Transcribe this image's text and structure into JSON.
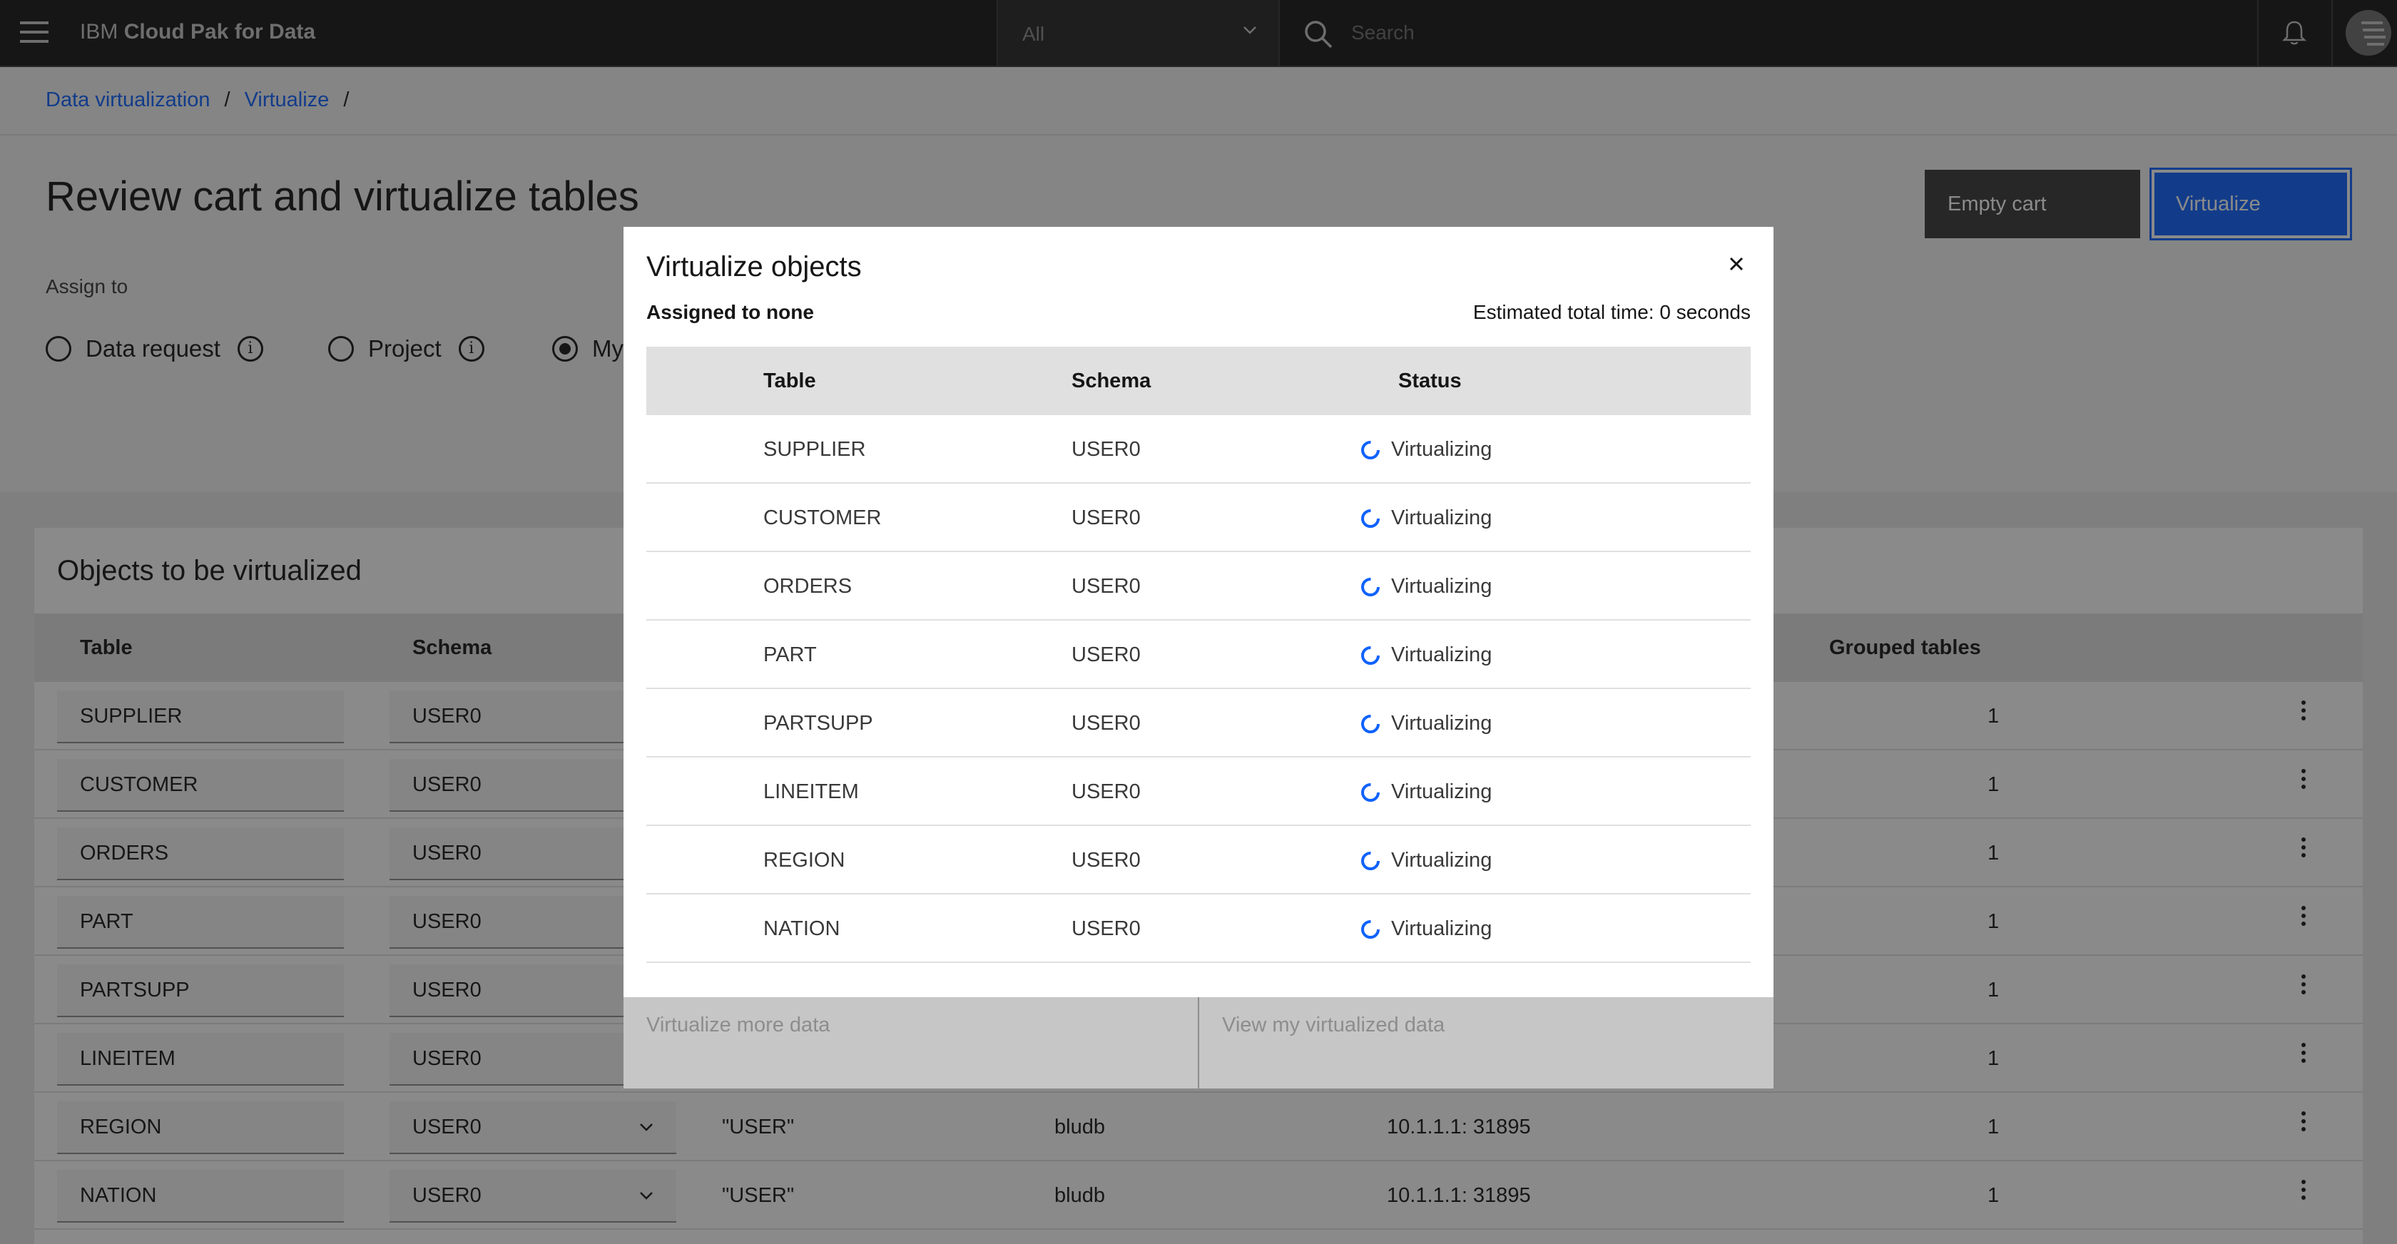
{
  "header": {
    "brand_prefix": "IBM",
    "brand_name": "Cloud Pak for Data",
    "scope_value": "All",
    "search_placeholder": "Search"
  },
  "breadcrumb": [
    "Data virtualization",
    "Virtualize"
  ],
  "page": {
    "title": "Review cart and virtualize tables",
    "empty_cart_label": "Empty cart",
    "virtualize_label": "Virtualize",
    "assign_label": "Assign to",
    "radio_options": [
      "Data request",
      "Project",
      "My"
    ],
    "selected_radio": "My"
  },
  "objects_panel": {
    "title": "Objects to be virtualized",
    "columns": [
      "Table",
      "Schema",
      "Grouped tables"
    ],
    "rows": [
      {
        "table": "SUPPLIER",
        "schema": "USER0",
        "grouped": "1"
      },
      {
        "table": "CUSTOMER",
        "schema": "USER0",
        "grouped": "1"
      },
      {
        "table": "ORDERS",
        "schema": "USER0",
        "grouped": "1"
      },
      {
        "table": "PART",
        "schema": "USER0",
        "grouped": "1"
      },
      {
        "table": "PARTSUPP",
        "schema": "USER0",
        "grouped": "1"
      },
      {
        "table": "LINEITEM",
        "schema": "USER0",
        "grouped": "1"
      },
      {
        "table": "REGION",
        "schema": "USER0",
        "owner": "\"USER\"",
        "database": "bludb",
        "host": "10.1.1.1: 31895",
        "grouped": "1"
      },
      {
        "table": "NATION",
        "schema": "USER0",
        "owner": "\"USER\"",
        "database": "bludb",
        "host": "10.1.1.1: 31895",
        "grouped": "1"
      }
    ]
  },
  "modal": {
    "title": "Virtualize objects",
    "assigned": "Assigned to none",
    "estimated": "Estimated total time: 0 seconds",
    "columns": [
      "Table",
      "Schema",
      "Status"
    ],
    "rows": [
      {
        "table": "SUPPLIER",
        "schema": "USER0",
        "status": "Virtualizing"
      },
      {
        "table": "CUSTOMER",
        "schema": "USER0",
        "status": "Virtualizing"
      },
      {
        "table": "ORDERS",
        "schema": "USER0",
        "status": "Virtualizing"
      },
      {
        "table": "PART",
        "schema": "USER0",
        "status": "Virtualizing"
      },
      {
        "table": "PARTSUPP",
        "schema": "USER0",
        "status": "Virtualizing"
      },
      {
        "table": "LINEITEM",
        "schema": "USER0",
        "status": "Virtualizing"
      },
      {
        "table": "REGION",
        "schema": "USER0",
        "status": "Virtualizing"
      },
      {
        "table": "NATION",
        "schema": "USER0",
        "status": "Virtualizing"
      }
    ],
    "footer_secondary": "Virtualize more data",
    "footer_primary": "View my virtualized data"
  },
  "icons": {
    "menu": "hamburger-menu-icon",
    "chevron": "chevron-down-icon",
    "search": "search-icon",
    "notification": "bell-icon",
    "user": "avatar-icon",
    "info": "information-icon",
    "overflow": "overflow-menu-icon",
    "close": "close-icon",
    "status": "spinner-icon"
  },
  "colors": {
    "accent": "#0f62fe",
    "header_bg": "#161616"
  }
}
